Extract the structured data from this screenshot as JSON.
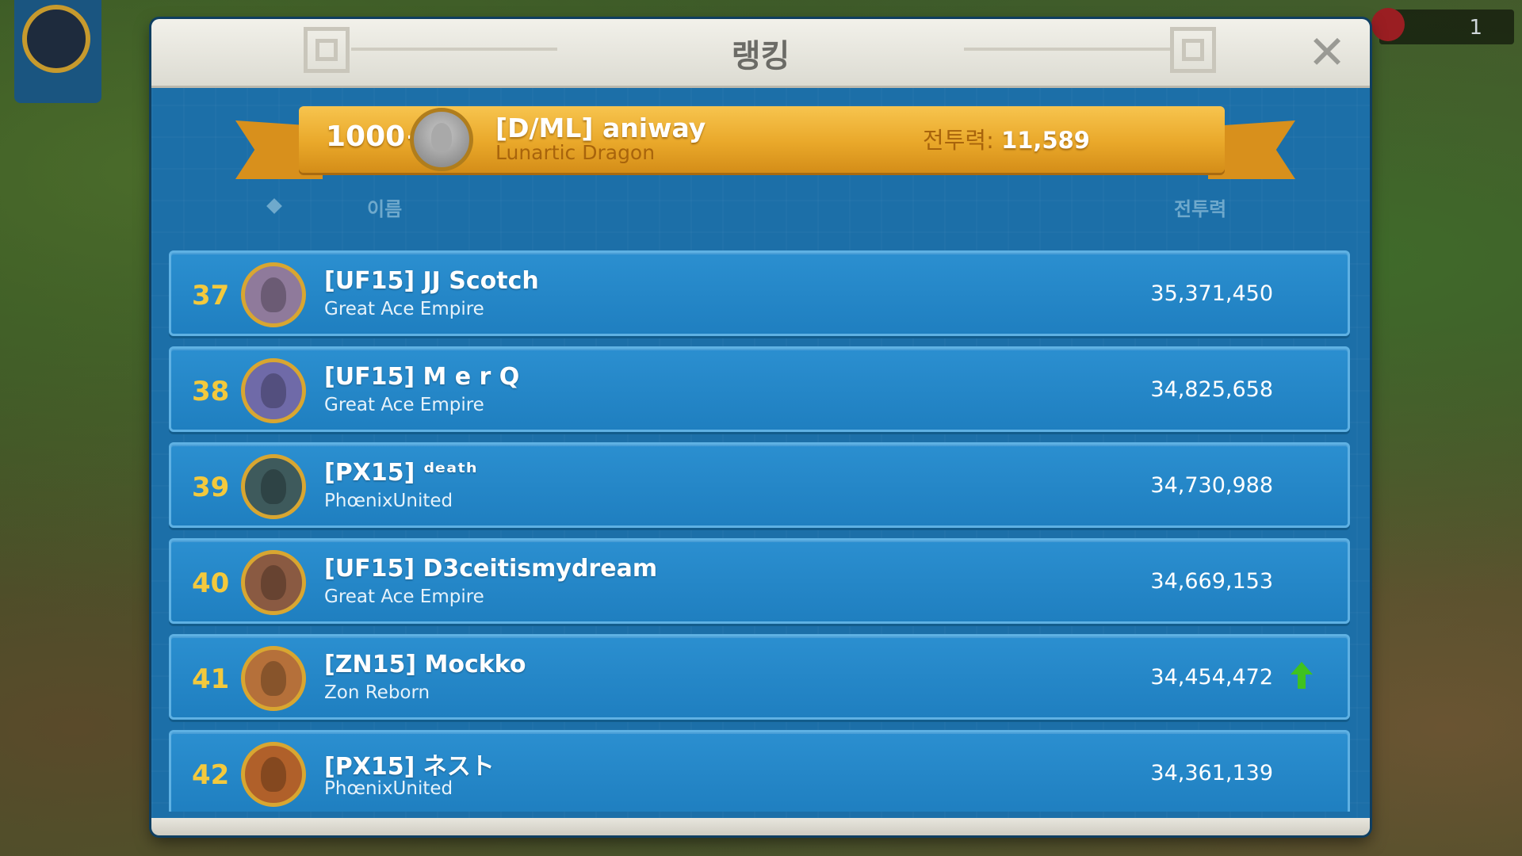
{
  "title": "랭킹",
  "close_icon": "✕",
  "my_entry": {
    "rank": "1000+",
    "name": "[D/ML] aniway",
    "guild": "Lunartic Dragon",
    "power_label": "전투력: ",
    "power_value": "11,589"
  },
  "columns": {
    "name": "이름",
    "power": "전투력"
  },
  "rows": [
    {
      "rank": "37",
      "name": "[UF15] JJ Scotch",
      "guild": "Great Ace Empire",
      "power": "35,371,450",
      "avatar_color": "#8f7a9b"
    },
    {
      "rank": "38",
      "name": "[UF15] M e r Q",
      "guild": "Great Ace Empire",
      "power": "34,825,658",
      "avatar_color": "#6f6aa8"
    },
    {
      "rank": "39",
      "name": "[PX15] ᵈᵉᵃᵗʰ",
      "guild": "PhœnixUnited",
      "power": "34,730,988",
      "avatar_color": "#3e5a5c"
    },
    {
      "rank": "40",
      "name": "[UF15] D3ceitismydream",
      "guild": "Great Ace Empire",
      "power": "34,669,153",
      "avatar_color": "#8a5a42"
    },
    {
      "rank": "41",
      "name": "[ZN15] Mockko",
      "guild": "Zon Reborn",
      "power": "34,454,472",
      "avatar_color": "#b5703a",
      "trend": "up"
    },
    {
      "rank": "42",
      "name": "[PX15] ネスト",
      "guild": "PhœnixUnited",
      "power": "34,361,139",
      "avatar_color": "#b0602a"
    }
  ],
  "colors": {
    "panel": "#1c6fa8",
    "row": "#2589c9",
    "rank": "#f3c93d",
    "ribbon": "#e9a82a",
    "trend_up": "#3fc21f"
  },
  "hud": {
    "counter": "1"
  }
}
